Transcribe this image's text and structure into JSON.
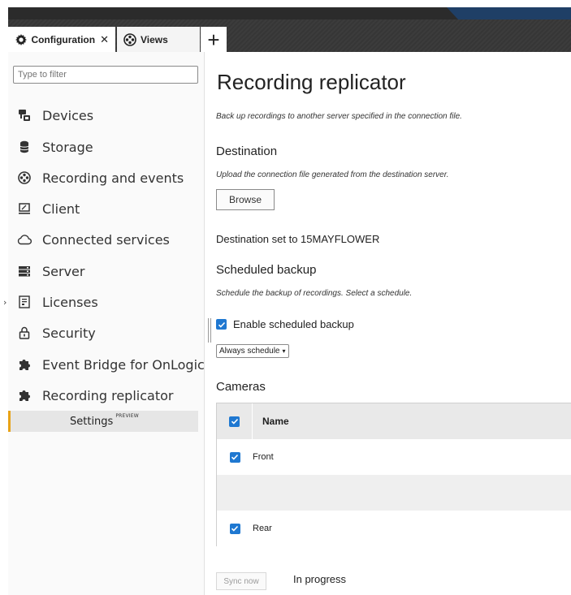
{
  "tabs": [
    {
      "label": "Configuration",
      "close": "✕",
      "icon": "gear-icon"
    },
    {
      "label": "Views",
      "icon": "film-reel-icon"
    }
  ],
  "tab_add": "+",
  "sidebar": {
    "filter_placeholder": "Type to filter",
    "items": [
      {
        "label": "Devices",
        "icon": "camera-device-icon"
      },
      {
        "label": "Storage",
        "icon": "database-icon"
      },
      {
        "label": "Recording and events",
        "icon": "film-reel-icon"
      },
      {
        "label": "Client",
        "icon": "monitor-icon"
      },
      {
        "label": "Connected services",
        "icon": "cloud-icon"
      },
      {
        "label": "Server",
        "icon": "server-icon"
      },
      {
        "label": "Licenses",
        "icon": "license-icon"
      },
      {
        "label": "Security",
        "icon": "lock-icon"
      },
      {
        "label": "Event Bridge for OnLogic",
        "icon": "puzzle-icon"
      },
      {
        "label": "Recording replicator",
        "icon": "puzzle-icon"
      }
    ],
    "subitem": {
      "label": "Settings",
      "badge": "PREVIEW"
    }
  },
  "main": {
    "title": "Recording replicator",
    "intro": "Back up recordings to another server specified in the connection file.",
    "destination": {
      "heading": "Destination",
      "desc": "Upload the connection file generated from the destination server.",
      "browse_label": "Browse",
      "status": "Destination set to 15MAYFLOWER"
    },
    "scheduled": {
      "heading": "Scheduled backup",
      "desc": "Schedule the backup of recordings. Select a schedule.",
      "enable_label": "Enable scheduled backup",
      "enable_checked": true,
      "schedule_value": "Always schedule"
    },
    "cameras": {
      "heading": "Cameras",
      "column": "Name",
      "rows": [
        {
          "name": "Front",
          "checked": true
        },
        {
          "name": "",
          "checked": false
        },
        {
          "name": "Rear",
          "checked": true
        }
      ]
    },
    "sync_label": "Sync now",
    "sync_status": "In progress"
  },
  "colors": {
    "accent": "#1f78d1",
    "selection_bar": "#e8a317"
  }
}
